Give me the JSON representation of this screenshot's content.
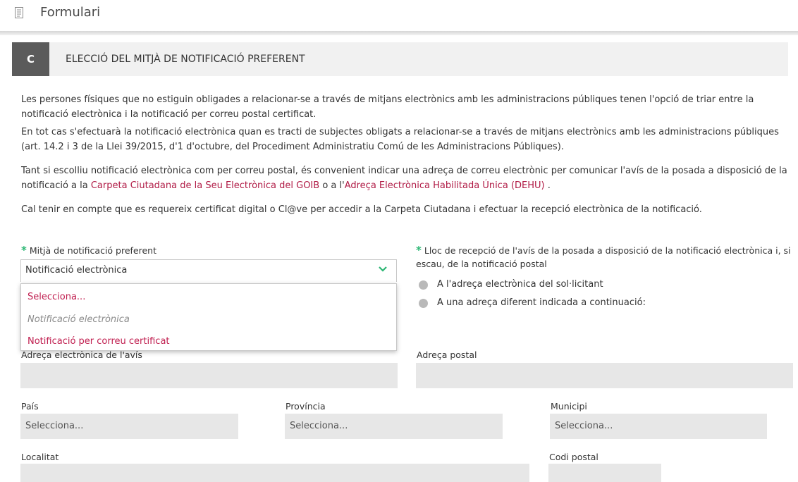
{
  "header": {
    "title": "Formulari",
    "icon": "document-icon"
  },
  "section": {
    "letter": "C",
    "title": "ELECCIÓ DEL MITJÀ DE NOTIFICACIÓ PREFERENT"
  },
  "paragraphs": {
    "p1": "Les persones físiques que no estiguin obligades a relacionar-se a través de mitjans electrònics amb les administracions públiques tenen l'opció de triar entre la notificació electrònica i la notificació per correu postal certificat.",
    "p2": "En tot cas s'efectuarà la notificació electrònica quan es tracti de subjectes obligats a relacionar-se a través de mitjans electrònics amb les administracions públiques (art. 14.2 i 3 de la Llei 39/2015, d'1 d'octubre, del Procediment Administratiu Comú de les Administracions Públiques).",
    "p3_prefix": "Tant si escolliu notificació electrònica com per correu postal, és convenient indicar una adreça de correu electrònic per comunicar l'avís de la posada a disposició de la notificació a la ",
    "p3_link1": "Carpeta Ciutadana de la Seu Electrònica del GOIB",
    "p3_middle": " o a l'",
    "p3_link2": "Adreça Electrònica Habilitada Única (DEHU)",
    "p3_suffix": " .",
    "p4": "Cal tenir en compte que es requereix certificat digital o Cl@ve per accedir a la Carpeta Ciutadana i efectuar la recepció electrònica de la notificació."
  },
  "notif": {
    "required_mark": "*",
    "label": "Mitjà de notificació preferent",
    "selected": "Notificació electrònica",
    "options": [
      "Selecciona...",
      "Notificació electrònica",
      "Notificació per correu certificat"
    ]
  },
  "lloc": {
    "required_mark": "*",
    "label": "Lloc de recepció de l'avís de la posada a disposició de la notificació electrònica i, si escau, de la notificació postal",
    "radios": [
      "A l'adreça electrònica del sol·licitant",
      "A una adreça diferent indicada a continuació:"
    ]
  },
  "fields": {
    "adreca_avis_label": "Adreça electrònica de l'avís",
    "adreca_postal_label": "Adreça postal",
    "pais_label": "País",
    "pais_value": "Selecciona...",
    "provincia_label": "Província",
    "provincia_value": "Selecciona...",
    "municipi_label": "Municipi",
    "municipi_value": "Selecciona...",
    "localitat_label": "Localitat",
    "codi_postal_label": "Codi postal"
  },
  "colors": {
    "link": "#b01a45",
    "required": "#2bb673",
    "field_bg": "#e7e7e7",
    "section_letter_bg": "#5b5b5b"
  }
}
